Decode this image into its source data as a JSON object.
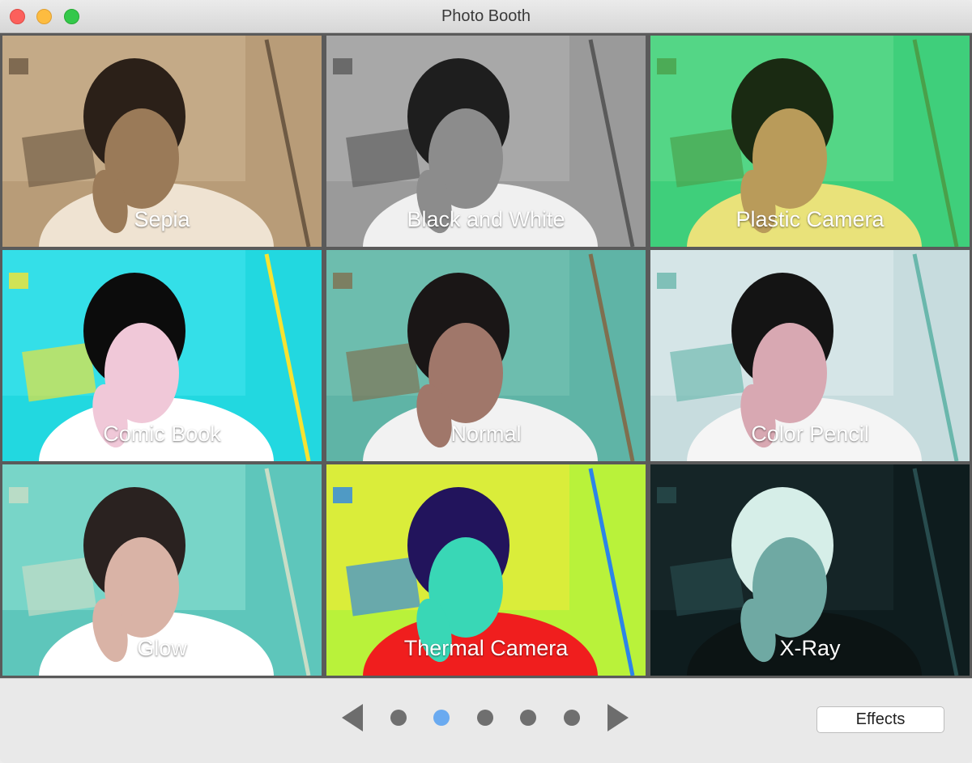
{
  "window": {
    "title": "Photo Booth"
  },
  "effects": [
    {
      "label": "Sepia",
      "colors": {
        "bg": "#b89c78",
        "wall": "#cdb694",
        "shirt": "#efe3d2",
        "skin": "#9a7a58",
        "hair": "#2b2018",
        "accent": "#6e5a44"
      }
    },
    {
      "label": "Black and White",
      "colors": {
        "bg": "#9a9a9a",
        "wall": "#b5b5b5",
        "shirt": "#f0f0f0",
        "skin": "#8c8c8c",
        "hair": "#1e1e1e",
        "accent": "#5a5a5a"
      }
    },
    {
      "label": "Plastic Camera",
      "colors": {
        "bg": "#3fcf7b",
        "wall": "#66dd90",
        "shirt": "#e9e27a",
        "skin": "#b99b5a",
        "hair": "#1a2a12",
        "accent": "#4aa04a"
      }
    },
    {
      "label": "Comic Book",
      "colors": {
        "bg": "#22d8e0",
        "wall": "#43e6ee",
        "shirt": "#ffffff",
        "skin": "#f0c8d8",
        "hair": "#0c0c0c",
        "accent": "#f7e331"
      }
    },
    {
      "label": "Normal",
      "colors": {
        "bg": "#5fb4a6",
        "wall": "#79c4b4",
        "shirt": "#f2f2f2",
        "skin": "#a0776a",
        "hair": "#1a1616",
        "accent": "#7f6f4f"
      }
    },
    {
      "label": "Color Pencil",
      "colors": {
        "bg": "#c7dcde",
        "wall": "#e0ecee",
        "shirt": "#f5f5f5",
        "skin": "#d8a8b2",
        "hair": "#141414",
        "accent": "#6ab7ac"
      }
    },
    {
      "label": "Glow",
      "colors": {
        "bg": "#5ec6bb",
        "wall": "#8ee2d3",
        "shirt": "#ffffff",
        "skin": "#d9b3a6",
        "hair": "#2a2220",
        "accent": "#c9ddc6"
      }
    },
    {
      "label": "Thermal Camera",
      "colors": {
        "bg": "#b9f23a",
        "wall": "#f5e93a",
        "shirt": "#f01e1e",
        "skin": "#39d7b6",
        "hair": "#22145c",
        "accent": "#2c84e8"
      }
    },
    {
      "label": "X-Ray",
      "colors": {
        "bg": "#0e1c1e",
        "wall": "#1b2e30",
        "shirt": "#0c1414",
        "skin": "#6fa9a3",
        "hair": "#d6eee8",
        "accent": "#284c4e"
      }
    }
  ],
  "pagination": {
    "pages": 5,
    "current": 2
  },
  "toolbar": {
    "effects_label": "Effects"
  }
}
